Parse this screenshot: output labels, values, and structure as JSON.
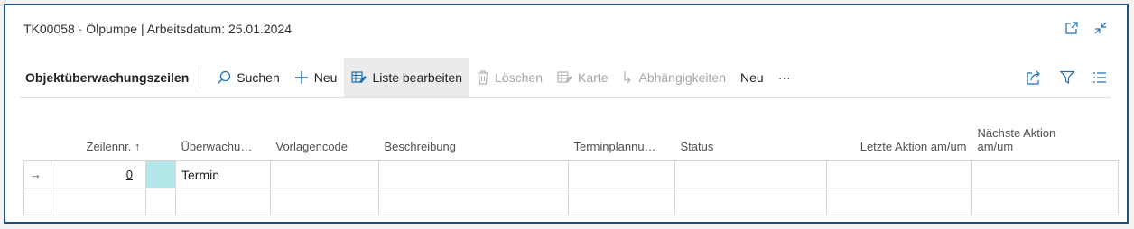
{
  "window": {
    "title": "TK00058 · Ölpumpe | Arbeitsdatum: 25.01.2024",
    "open_new_icon": "open-in-new-window-icon",
    "collapse_icon": "collapse-icon"
  },
  "toolbar": {
    "section_title": "Objektüberwachungszeilen",
    "search_label": "Suchen",
    "new_label": "Neu",
    "edit_list_label": "Liste bearbeiten",
    "delete_label": "Löschen",
    "card_label": "Karte",
    "dependencies_label": "Abhängigkeiten",
    "new2_label": "Neu",
    "more_label": "···"
  },
  "table": {
    "headers": {
      "line_no": "Zeilennr. ↑",
      "monitoring": "Überwachu…",
      "template": "Vorlagencode",
      "description": "Beschreibung",
      "scheduling": "Terminplannu…",
      "status": "Status",
      "last_action": "Letzte Aktion am/um",
      "next_action_1": "Nächste Aktion",
      "next_action_2": "am/um"
    },
    "rows": [
      {
        "marker": "→",
        "line_no": "0",
        "monitoring": "Termin"
      }
    ]
  },
  "colors": {
    "frame_border": "#1f4e79",
    "selected_cell": "#b3e7ea",
    "active_button": "#ebebeb"
  }
}
